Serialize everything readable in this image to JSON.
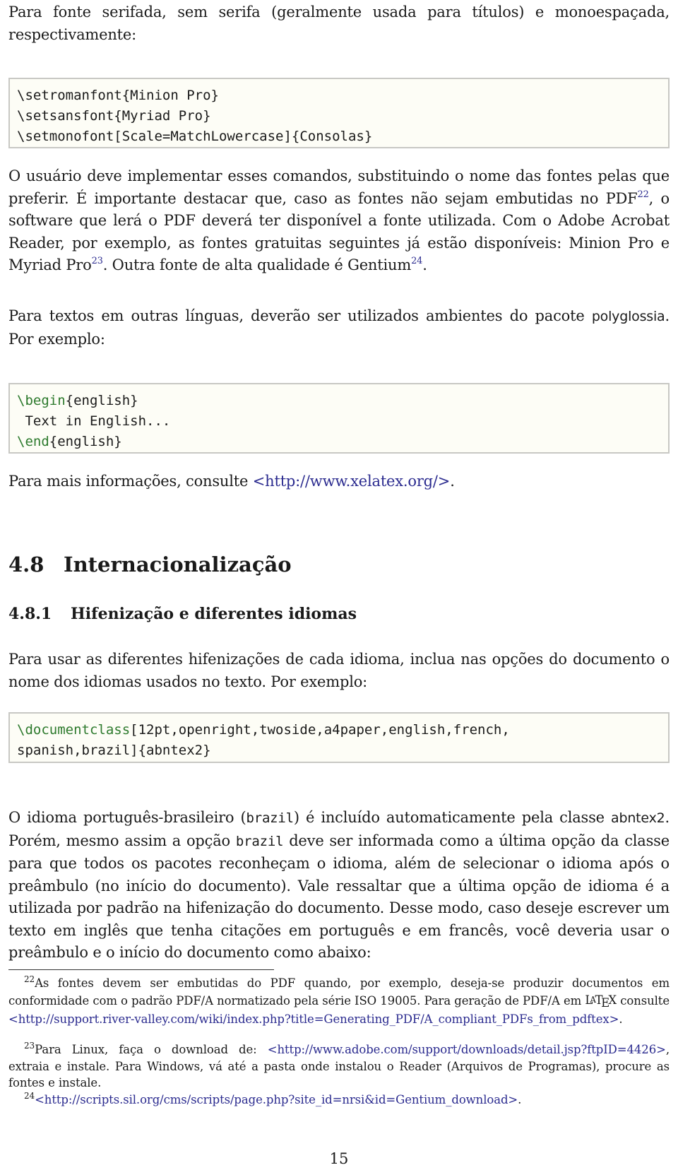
{
  "intro": {
    "text": "Para fonte serifada, sem serifa (geralmente usada para títulos) e monoespaçada, respectivamente:"
  },
  "code_fonts": {
    "lines": [
      "\\setromanfont{Minion Pro}",
      "\\setsansfont{Myriad Pro}",
      "\\setmonofont[Scale=MatchLowercase]{Consolas}"
    ]
  },
  "para_fonts": {
    "part1": "O usuário deve implementar esses comandos, substituindo o nome das fontes pelas que preferir. É importante destacar que, caso as fontes não sejam embutidas no PDF",
    "fn1": "22",
    "part2": ", o software que lerá o PDF deverá ter disponível a fonte utilizada. Com o Adobe Acrobat Reader, por exemplo, as fontes gratuitas seguintes já estão disponíveis: Minion Pro e Myriad Pro",
    "fn2": "23",
    "part3": ". Outra fonte de alta qualidade é Gentium",
    "fn3": "24",
    "part4": "."
  },
  "para_polyglossia": {
    "text": "Para textos em outras línguas, deverão ser utilizados ambientes do pacote ",
    "package": "polyglossia",
    "after": ". Por exemplo:"
  },
  "code_english": {
    "begin_kw": "\\begin",
    "begin_arg": "{english}",
    "body": " Text in English...",
    "end_kw": "\\end",
    "end_arg": "{english}"
  },
  "para_more_info": {
    "text": "Para mais informações, consulte ",
    "link": "<http://www.xelatex.org/>",
    "after": "."
  },
  "section": {
    "number": "4.8",
    "title": "Internacionalização"
  },
  "subsection": {
    "number": "4.8.1",
    "title": "Hifenização e diferentes idiomas"
  },
  "para_hyphen": {
    "text": "Para usar as diferentes hifenizações de cada idioma, inclua nas opções do documento o nome dos idiomas usados no texto. Por exemplo:"
  },
  "code_docclass": {
    "kw": "\\documentclass",
    "line1_rest": "[12pt,openright,twoside,a4paper,english,french,",
    "line2": "spanish,brazil]{abntex2}"
  },
  "para_brazil": {
    "t1": "O idioma português-brasileiro (",
    "code1": "brazil",
    "t2": ") é incluído automaticamente pela classe ",
    "pkg": "abntex2",
    "t3": ". Porém, mesmo assim a opção ",
    "code2": "brazil",
    "t4": " deve ser informada como a última opção da classe para que todos os pacotes reconheçam o idioma, além de selecionar o idioma após o preâmbulo (no início do documento). Vale ressaltar que a última opção de idioma é a utilizada por padrão na hifenização do documento. Desse modo, caso deseje escrever um texto em inglês que tenha citações em português e em francês, você deveria usar o preâmbulo e o início do documento como abaixo:"
  },
  "footnotes": [
    {
      "mark": "22",
      "text": "As fontes devem ser embutidas do PDF quando, por exemplo, deseja-se produzir documentos em conformidade com o padrão PDF/A normatizado pela série ISO 19005. Para geração de PDF/A em ",
      "latex_L": "L",
      "latex_A": "A",
      "latex_T": "T",
      "latex_E": "E",
      "latex_X": "X",
      "text2": " consulte ",
      "link": "<http://support.river-valley.com/wiki/index.php?title=Generating_PDF/A_compliant_PDFs_from_pdftex>",
      "after": "."
    },
    {
      "mark": "23",
      "text": "Para Linux, faça o download de: ",
      "link": "<http://www.adobe.com/support/downloads/detail.jsp?ftpID=4426>",
      "after": ", extraia e instale. Para Windows, vá até a pasta onde instalou o Reader (Arquivos de Programas), procure as fontes e instale."
    },
    {
      "mark": "24",
      "link": "<http://scripts.sil.org/cms/scripts/page.php?site_id=nrsi&id=Gentium_download>",
      "after": "."
    }
  ],
  "page_number": "15",
  "colors": {
    "link": "#2b2b8f",
    "keyword": "#2d7a2d",
    "code_bg": "#fdfdf6",
    "code_border": "#c8c8c4"
  }
}
